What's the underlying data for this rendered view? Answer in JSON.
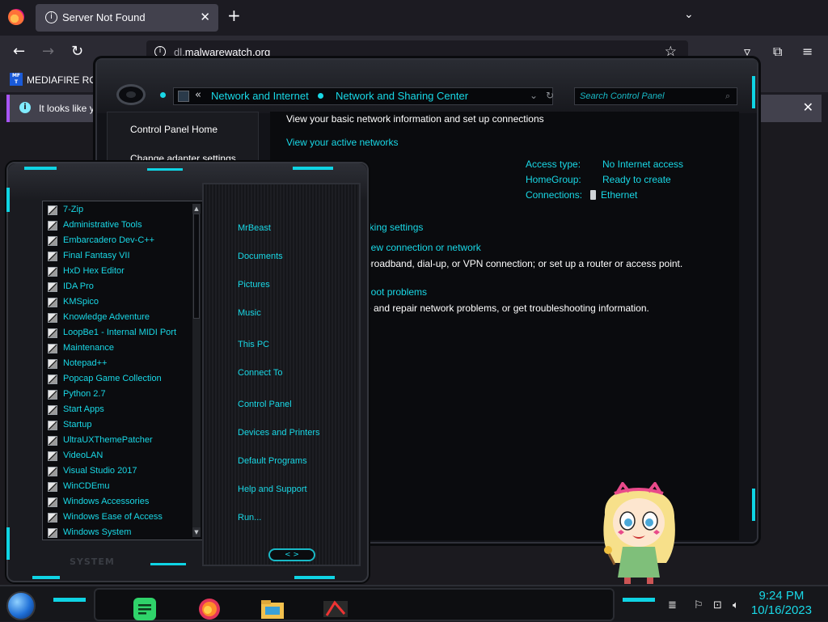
{
  "browser": {
    "tab_title": "Server Not Found",
    "url_host": "dl.",
    "url_domain": "malwarewatch.org",
    "bookmark_label": "MEDIAFIRE RO",
    "bookmark_icon_text": "MF T",
    "notice_text": "It looks like y"
  },
  "control_panel": {
    "breadcrumb_sep": "«",
    "breadcrumbs": [
      "Network and Internet",
      "Network and Sharing Center"
    ],
    "search_placeholder": "Search Control Panel",
    "sidebar": [
      "Control Panel Home",
      "Change adapter settings"
    ],
    "heading": "View your basic network information and set up connections",
    "active_networks": "View your active networks",
    "info_labels": [
      "Access type:",
      "HomeGroup:",
      "Connections:"
    ],
    "info_values": [
      "No Internet access",
      "Ready to create",
      "Ethernet"
    ],
    "change_settings": "orking settings",
    "new_connection_link": "new connection or network",
    "new_connection_desc": "broadband, dial-up, or VPN connection; or set up a router or access point.",
    "troubleshoot_link": "hoot problems",
    "troubleshoot_desc": "e and repair network problems, or get troubleshooting information."
  },
  "start_menu": {
    "programs": [
      "7-Zip",
      "Administrative Tools",
      "Embarcadero Dev-C++",
      "Final Fantasy VII",
      "HxD Hex Editor",
      "IDA Pro",
      "KMSpico",
      "Knowledge Adventure",
      "LoopBe1 - Internal MIDI Port",
      "Maintenance",
      "Notepad++",
      "Popcap Game Collection",
      "Python 2.7",
      "Start Apps",
      "Startup",
      "UltraUXThemePatcher",
      "VideoLAN",
      "Visual Studio 2017",
      "WinCDEmu",
      "Windows Accessories",
      "Windows Ease of Access",
      "Windows System"
    ],
    "places": [
      "MrBeast",
      "Documents",
      "Pictures",
      "Music",
      "This PC",
      "Connect To",
      "Control Panel",
      "Devices and Printers",
      "Default Programs",
      "Help and Support",
      "Run..."
    ],
    "footer_label": "SYSTEM",
    "nav_button": "< >"
  },
  "taskbar": {
    "time": "9:24 PM",
    "date": "10/16/2023"
  },
  "colors": {
    "accent": "#19d8e6",
    "panel_bg": "#0a0b0e"
  }
}
